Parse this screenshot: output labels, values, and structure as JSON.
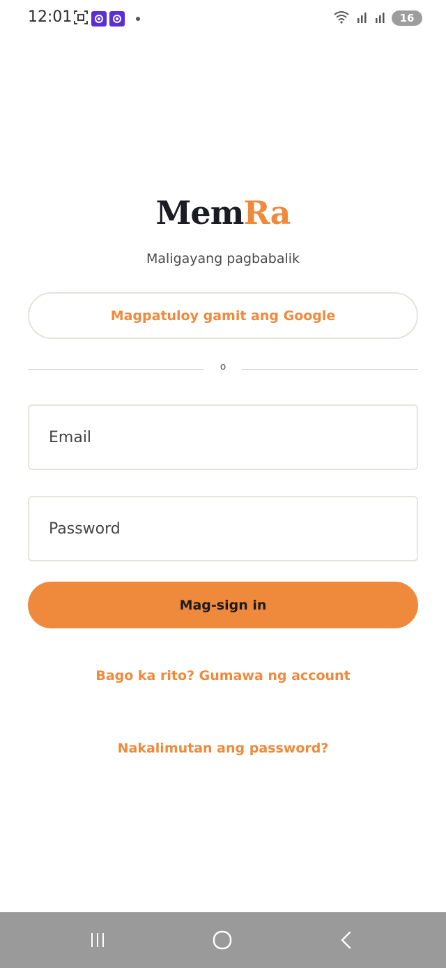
{
  "status_bar": {
    "time": "12:01",
    "battery_level": "16",
    "icons": [
      "screenshot-icon",
      "app-notification-icon",
      "app-notification-icon",
      "dot-icon",
      "wifi-icon",
      "signal-icon",
      "signal-icon",
      "battery-icon"
    ]
  },
  "brand": {
    "name_part1": "Mem",
    "name_part2": "Ra",
    "color_primary": "#1b1b22",
    "color_accent": "#ef8a3d"
  },
  "login": {
    "subtitle": "Maligayang pagbabalik",
    "google_button_label": "Magpatuloy gamit ang Google",
    "divider_text": "o",
    "email_placeholder": "Email",
    "password_placeholder": "Password",
    "signin_label": "Mag-sign in",
    "create_account_link": "Bago ka rito? Gumawa ng account",
    "forgot_password_link": "Nakalimutan ang password?"
  },
  "nav_bar": {
    "buttons": [
      "recents-icon",
      "home-icon",
      "back-icon"
    ]
  }
}
